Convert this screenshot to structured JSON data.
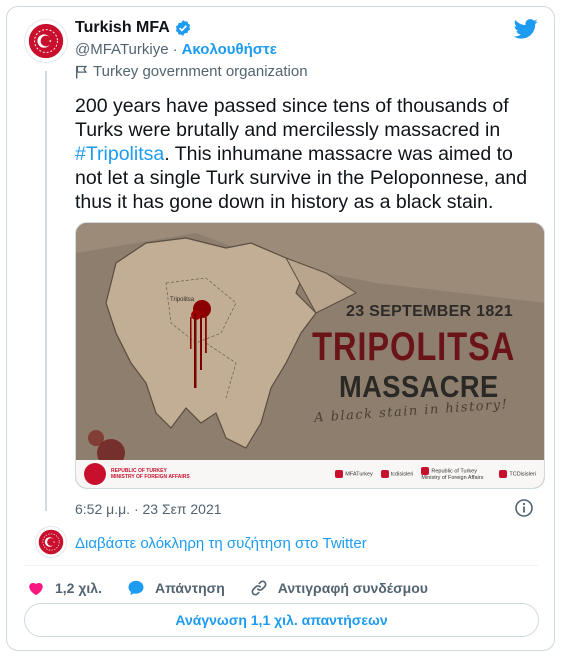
{
  "account": {
    "name": "Turkish MFA",
    "handle": "@MFATurkiye",
    "separator": "·",
    "follow_label": "Ακολουθήστε",
    "org_label": "Turkey government organization"
  },
  "tweet": {
    "text_before": "200 years have passed since tens of thousands of Turks were brutally and mercilessly massacred in ",
    "hashtag": "#Tripolitsa",
    "text_after": ". This inhumane massacre was aimed to not let a single Turk survive in the Peloponnese, and thus it has gone down in history as a black stain.",
    "timestamp": "6:52 μ.μ. · 23 Σεπ 2021"
  },
  "media": {
    "date": "23 SEPTEMBER 1821",
    "title_line1": "TRIPOLITSA",
    "title_line2": "MASSACRE",
    "tagline": "A black stain in history!",
    "map_label": "Tripolitsa",
    "footer_org_line1": "REPUBLIC OF TURKEY",
    "footer_org_line2": "MINISTRY OF FOREIGN AFFAIRS",
    "footer_links": [
      "MFATurkey",
      "tcdisisleri",
      "Republic of Turkey Ministry of Foreign Affairs",
      "TCDisisleri"
    ]
  },
  "conversation": {
    "link_label": "Διαβάστε ολόκληρη τη συζήτηση στο Twitter"
  },
  "actions": {
    "likes": "1,2 χιλ.",
    "reply_label": "Απάντηση",
    "copy_link_label": "Αντιγραφή συνδέσμου"
  },
  "replies_button": "Ανάγνωση 1,1 χιλ. απαντήσεων",
  "colors": {
    "accent": "#1d9bf0",
    "like": "#f91880",
    "seal_red": "#c8102e",
    "title_red": "#6b1418"
  },
  "icons": [
    "verified-badge-icon",
    "flag-icon",
    "twitter-bird-icon",
    "info-icon",
    "heart-icon",
    "reply-bubble-icon",
    "link-icon"
  ]
}
